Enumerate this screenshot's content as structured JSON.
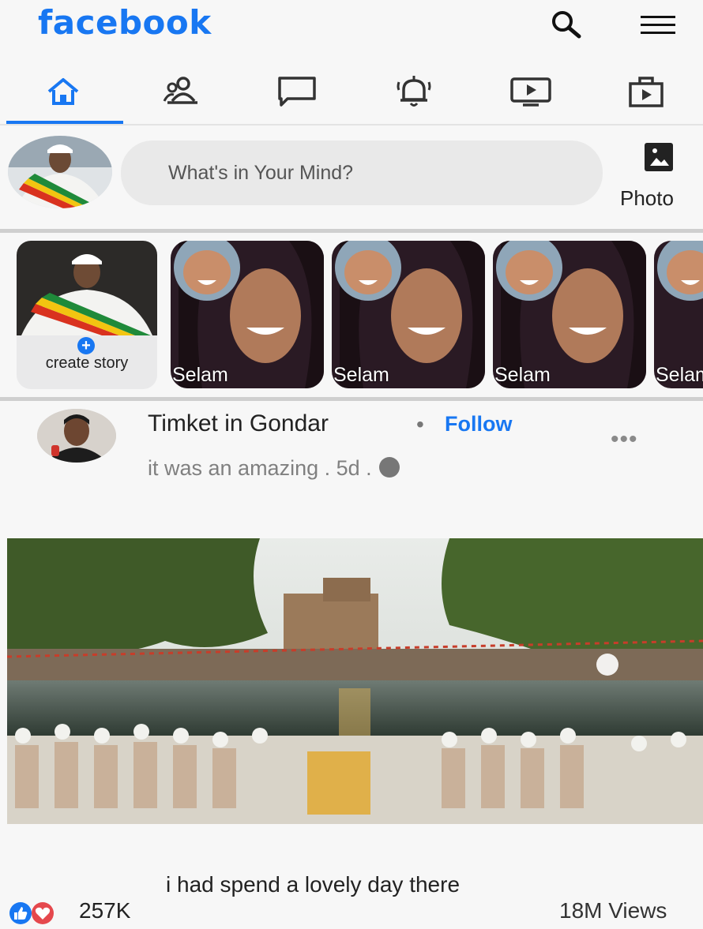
{
  "header": {
    "logo": "facebook",
    "search_icon": "search-icon",
    "menu_icon": "hamburger-menu-icon"
  },
  "nav_tabs": [
    {
      "id": "home",
      "icon": "home-icon",
      "active": true
    },
    {
      "id": "friends",
      "icon": "friends-icon",
      "active": false
    },
    {
      "id": "messages",
      "icon": "message-icon",
      "active": false
    },
    {
      "id": "notifications",
      "icon": "bell-icon",
      "active": false
    },
    {
      "id": "watch",
      "icon": "video-icon",
      "active": false
    },
    {
      "id": "marketplace",
      "icon": "briefcase-icon",
      "active": false
    }
  ],
  "composer": {
    "placeholder": "What's in Your Mind?",
    "photo_label": "Photo"
  },
  "stories": {
    "create_label": "create story",
    "items": [
      {
        "name": "Selam"
      },
      {
        "name": "Selam"
      },
      {
        "name": "Selam"
      },
      {
        "name": "Selam"
      }
    ]
  },
  "post": {
    "author": "Timket in Gondar",
    "separator": "•",
    "follow_label": "Follow",
    "subtitle": "it was an amazing  . 5d .",
    "more": "•••",
    "caption": "i had spend a lovely day there",
    "reaction_count": "257K",
    "views": "18M Views"
  },
  "colors": {
    "brand": "#1877f2",
    "background": "#f7f7f7"
  }
}
